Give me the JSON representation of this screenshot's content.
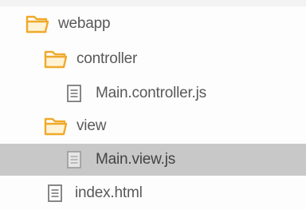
{
  "tree": {
    "items": [
      {
        "label": "webapp",
        "icon": "folder-open-icon"
      },
      {
        "label": "controller",
        "icon": "folder-open-icon"
      },
      {
        "label": "Main.controller.js",
        "icon": "file-icon"
      },
      {
        "label": "view",
        "icon": "folder-open-icon"
      },
      {
        "label": "Main.view.js",
        "icon": "file-icon",
        "selected": true
      },
      {
        "label": "index.html",
        "icon": "file-icon"
      }
    ]
  },
  "colors": {
    "folder": "#f4b73a",
    "folder_light": "#ffd77a",
    "selection": "#c8c8c8",
    "text": "#595959"
  }
}
